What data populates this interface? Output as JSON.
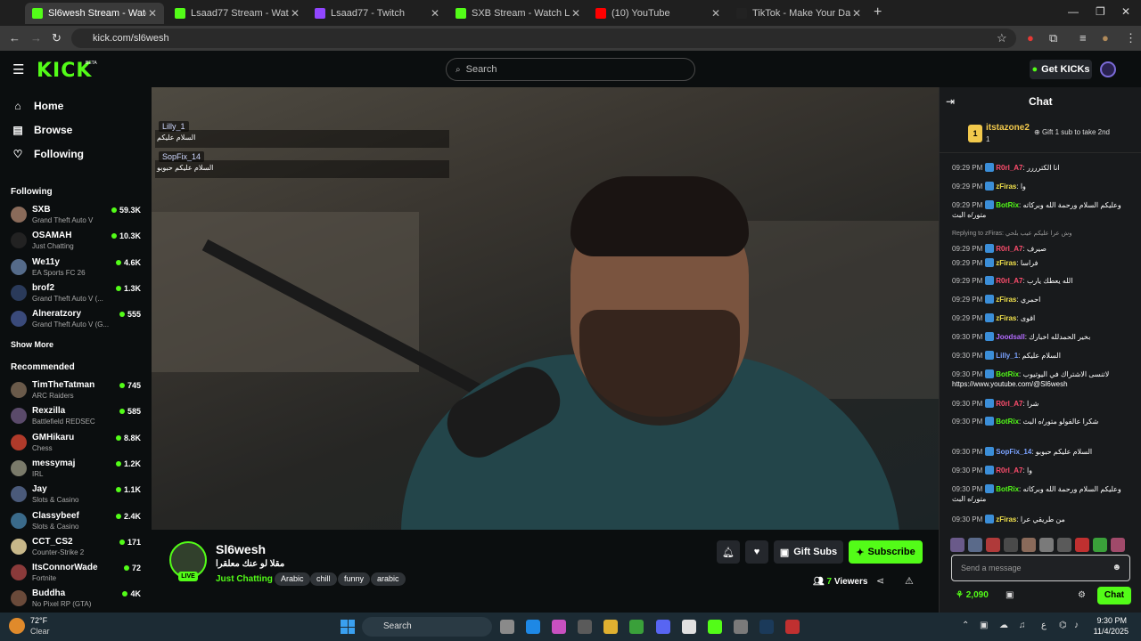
{
  "browser": {
    "tabs": [
      {
        "title": "Sl6wesh Stream - Watch Live",
        "active": true,
        "color": "#53fc18"
      },
      {
        "title": "Lsaad77 Stream - Watch Live on",
        "active": false,
        "color": "#53fc18"
      },
      {
        "title": "Lsaad77 - Twitch",
        "active": false,
        "color": "#9146ff"
      },
      {
        "title": "SXB Stream - Watch Live on Kic",
        "active": false,
        "color": "#53fc18"
      },
      {
        "title": "(10) YouTube",
        "active": false,
        "color": "#ff0000"
      },
      {
        "title": "TikTok - Make Your Day",
        "active": false,
        "color": "#222222"
      }
    ],
    "url": "kick.com/sl6wesh"
  },
  "header": {
    "logo": "KICK",
    "beta": "BETA",
    "search_placeholder": "Search",
    "get_kicks": "Get KICKs"
  },
  "sidebar": {
    "nav": [
      {
        "label": "Home",
        "icon": "home-icon",
        "glyph": "⌂"
      },
      {
        "label": "Browse",
        "icon": "browse-icon",
        "glyph": "▤"
      },
      {
        "label": "Following",
        "icon": "heart-icon",
        "glyph": "♡"
      }
    ],
    "following_title": "Following",
    "following": [
      {
        "name": "SXB",
        "game": "Grand Theft Auto V",
        "viewers": "59.3K",
        "color": "#8a6b5a"
      },
      {
        "name": "OSAMAH",
        "game": "Just Chatting",
        "viewers": "10.3K",
        "color": "#222222"
      },
      {
        "name": "We11y",
        "game": "EA Sports FC 26",
        "viewers": "4.6K",
        "color": "#556b8a"
      },
      {
        "name": "brof2",
        "game": "Grand Theft Auto V (...",
        "viewers": "1.3K",
        "color": "#2a3a5a"
      },
      {
        "name": "Alneratzory",
        "game": "Grand Theft Auto V (G...",
        "viewers": "555",
        "color": "#3a4a7a"
      }
    ],
    "show_more": "Show More",
    "recommended_title": "Recommended",
    "recommended": [
      {
        "name": "TimTheTatman",
        "game": "ARC Raiders",
        "viewers": "745",
        "color": "#6a5a4a"
      },
      {
        "name": "Rexzilla",
        "game": "Battlefield REDSEC",
        "viewers": "585",
        "color": "#5a4a6a"
      },
      {
        "name": "GMHikaru",
        "game": "Chess",
        "viewers": "8.8K",
        "color": "#b03a2a"
      },
      {
        "name": "messymaj",
        "game": "IRL",
        "viewers": "1.2K",
        "color": "#7a7a6a"
      },
      {
        "name": "Jay",
        "game": "Slots & Casino",
        "viewers": "1.1K",
        "color": "#4a5a7a"
      },
      {
        "name": "Classybeef",
        "game": "Slots & Casino",
        "viewers": "2.4K",
        "color": "#3a6a8a"
      },
      {
        "name": "CCT_CS2",
        "game": "Counter-Strike 2",
        "viewers": "171",
        "color": "#c8b88a"
      },
      {
        "name": "ItsConnorWade",
        "game": "Fortnite",
        "viewers": "72",
        "color": "#8a3a3a"
      },
      {
        "name": "Buddha",
        "game": "No Pixel RP (GTA)",
        "viewers": "4K",
        "color": "#6a4a3a"
      }
    ]
  },
  "video_overlay": [
    {
      "user": "Lilly_1",
      "message": "السلام عليكم"
    },
    {
      "user": "SopFix_14",
      "message": "السلام عليكم حبوبو"
    }
  ],
  "stream": {
    "channel": "Sl6wesh",
    "title": "مقلا لو عنك معلقرا",
    "live": "LIVE",
    "category": "Just Chatting",
    "tags": [
      "Arabic",
      "chill",
      "funny",
      "arabic"
    ],
    "gift_subs": "Gift Subs",
    "subscribe": "Subscribe",
    "viewers_count": "7",
    "viewers_label": "Viewers"
  },
  "chat": {
    "title": "Chat",
    "pinned": {
      "rank": "1",
      "user": "itstazone2",
      "count": "1",
      "gift_text": "Gift 1 sub to take 2nd"
    },
    "messages": [
      {
        "time": "09:29 PM",
        "user": "R0rl_A7",
        "color": "#ff4d6d",
        "text": "انا الكترررر"
      },
      {
        "time": "09:29 PM",
        "user": "zFiras",
        "color": "#f2e24c",
        "text": "وا"
      },
      {
        "time": "09:29 PM",
        "user": "BotRix",
        "color": "#53fc18",
        "text": "وعليكم السلام ورحمة الله وبركاته متور/ه البث"
      },
      {
        "time": "09:29 PM",
        "user": "R0rl_A7",
        "color": "#ff4d6d",
        "text": "صيرف",
        "reply": "Replying to zFiras: وش عرا عليكم عيب بلحي"
      },
      {
        "time": "09:29 PM",
        "user": "zFiras",
        "color": "#f2e24c",
        "text": "فراسا"
      },
      {
        "time": "09:29 PM",
        "user": "R0rl_A7",
        "color": "#ff4d6d",
        "text": "الله يعطك يارب"
      },
      {
        "time": "09:29 PM",
        "user": "zFiras",
        "color": "#f2e24c",
        "text": "احمري"
      },
      {
        "time": "09:29 PM",
        "user": "zFiras",
        "color": "#f2e24c",
        "text": "اقوى"
      },
      {
        "time": "09:30 PM",
        "user": "Joodsall",
        "color": "#b36bff",
        "text": "بخير الحمدلله اخبارك"
      },
      {
        "time": "09:30 PM",
        "user": "Lilly_1",
        "color": "#7aa2ff",
        "text": "السلام عليكم"
      },
      {
        "time": "09:30 PM",
        "user": "BotRix",
        "color": "#53fc18",
        "text": "لاتنسى الاشتراك في اليوتيوب https://www.youtube.com/@Sl6wesh"
      },
      {
        "time": "09:30 PM",
        "user": "R0rl_A7",
        "color": "#ff4d6d",
        "text": "شرا"
      },
      {
        "time": "09:30 PM",
        "user": "BotRix",
        "color": "#53fc18",
        "text": "شكرا عالفولو متور/ه البث"
      },
      {
        "time": "09:30 PM",
        "user": "SopFix_14",
        "color": "#7aa2ff",
        "text": "السلام عليكم حبوبو"
      },
      {
        "time": "09:30 PM",
        "user": "R0rl_A7",
        "color": "#ff4d6d",
        "text": "وا"
      },
      {
        "time": "09:30 PM",
        "user": "BotRix",
        "color": "#53fc18",
        "text": "وعليكم السلام ورحمة الله وبركاته متور/ه البث"
      },
      {
        "time": "09:30 PM",
        "user": "zFiras",
        "color": "#f2e24c",
        "text": "من طريقي عرا"
      }
    ],
    "input_placeholder": "Send a message",
    "points": "2,090",
    "send": "Chat"
  },
  "taskbar": {
    "temp": "72°F",
    "condition": "Clear",
    "search": "Search",
    "time": "9:30 PM",
    "date": "11/4/2025"
  }
}
